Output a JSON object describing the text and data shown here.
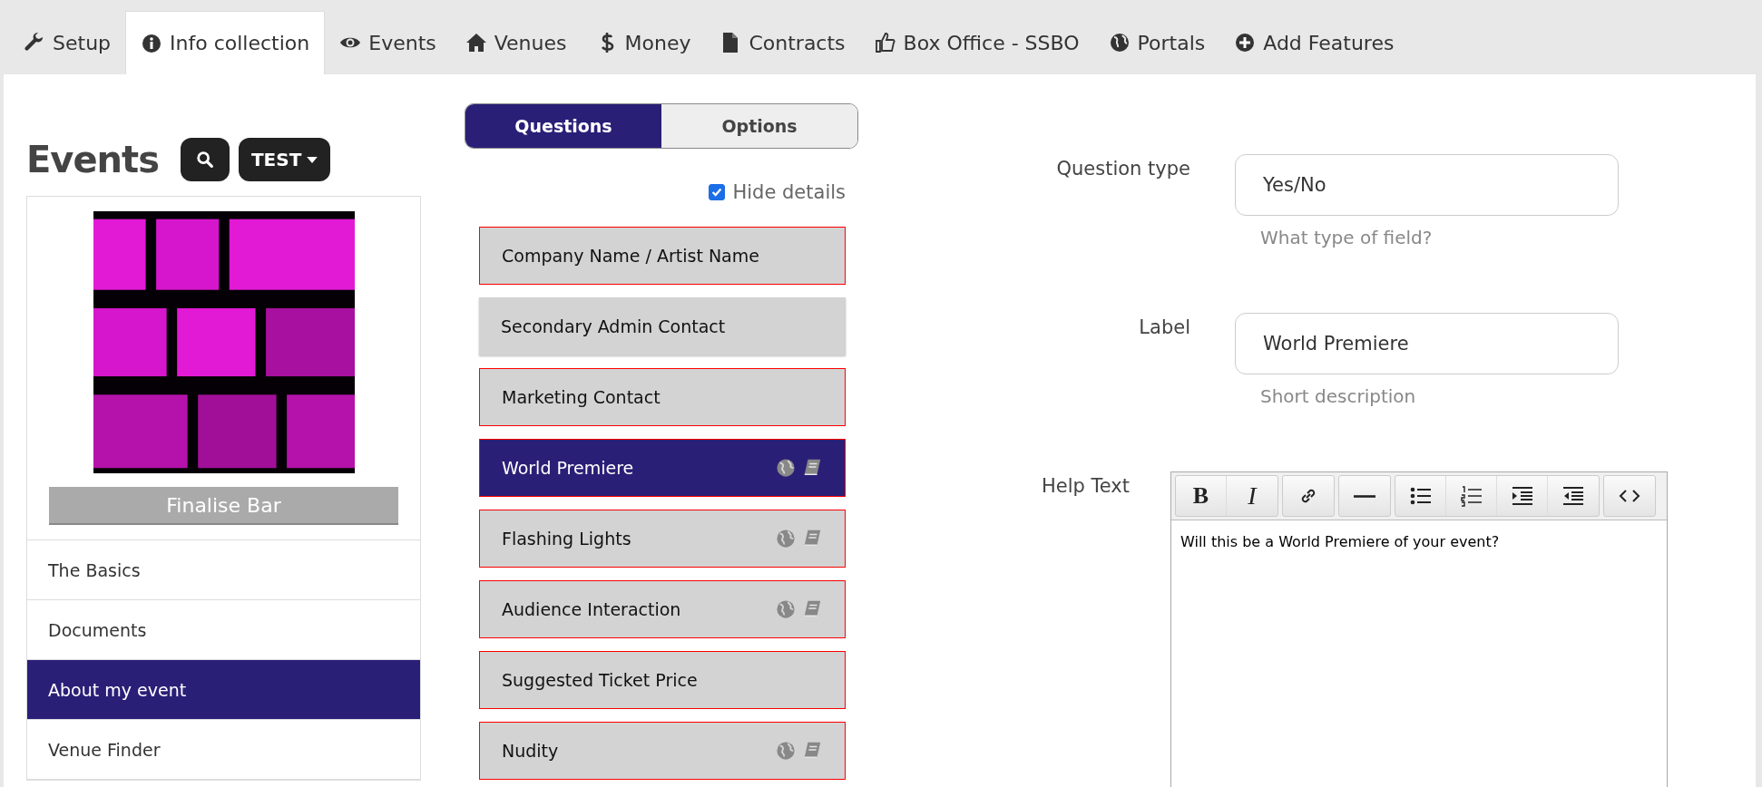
{
  "nav_tabs": [
    {
      "label": "Setup",
      "kind": "wrench",
      "selected": false
    },
    {
      "label": "Info collection",
      "kind": "info",
      "selected": true
    },
    {
      "label": "Events",
      "kind": "eye",
      "selected": false
    },
    {
      "label": "Venues",
      "kind": "home",
      "selected": false
    },
    {
      "label": "Money",
      "kind": "dollar",
      "selected": false
    },
    {
      "label": "Contracts",
      "kind": "file",
      "selected": false
    },
    {
      "label": "Box Office - SSBO",
      "kind": "thumb",
      "selected": false
    },
    {
      "label": "Portals",
      "kind": "globe",
      "selected": false
    },
    {
      "label": "Add Features",
      "kind": "plus",
      "selected": false
    }
  ],
  "sidebar": {
    "title": "Events",
    "filter_button": "TEST",
    "event_card": {
      "status_bar": "Finalise Bar"
    },
    "items": [
      {
        "label": "The Basics",
        "selected": false
      },
      {
        "label": "Documents",
        "selected": false
      },
      {
        "label": "About my event",
        "selected": true
      },
      {
        "label": "Venue Finder",
        "selected": false
      }
    ]
  },
  "segments": [
    {
      "label": "Questions",
      "selected": true
    },
    {
      "label": "Options",
      "selected": false
    }
  ],
  "hide_details": {
    "label": "Hide details",
    "checked": true
  },
  "questions": [
    {
      "label": "Company Name / Artist Name",
      "selected": false,
      "flagged": true,
      "icons": false
    },
    {
      "label": "Secondary Admin Contact",
      "selected": false,
      "flagged": false,
      "icons": false
    },
    {
      "label": "Marketing Contact",
      "selected": false,
      "flagged": true,
      "icons": false
    },
    {
      "label": "World Premiere",
      "selected": true,
      "flagged": true,
      "icons": true
    },
    {
      "label": "Flashing Lights",
      "selected": false,
      "flagged": true,
      "icons": true
    },
    {
      "label": "Audience Interaction",
      "selected": false,
      "flagged": true,
      "icons": true
    },
    {
      "label": "Suggested Ticket Price",
      "selected": false,
      "flagged": true,
      "icons": false
    },
    {
      "label": "Nudity",
      "selected": false,
      "flagged": true,
      "icons": true
    }
  ],
  "form": {
    "question_type": {
      "label": "Question type",
      "value": "Yes/No",
      "help": "What type of field?"
    },
    "label_field": {
      "label": "Label",
      "value": "World Premiere",
      "help": "Short description"
    },
    "help_text": {
      "label": "Help Text",
      "toolbar": [
        [
          {
            "kind": "bold",
            "label": "B"
          },
          {
            "kind": "italic",
            "label": "I"
          }
        ],
        [
          {
            "kind": "link"
          }
        ],
        [
          {
            "kind": "rule"
          }
        ],
        [
          {
            "kind": "bullets"
          },
          {
            "kind": "numbers"
          },
          {
            "kind": "indent"
          },
          {
            "kind": "outdent"
          }
        ],
        [
          {
            "kind": "code"
          }
        ]
      ],
      "content": "Will this be a World Premiere of your event?"
    }
  }
}
